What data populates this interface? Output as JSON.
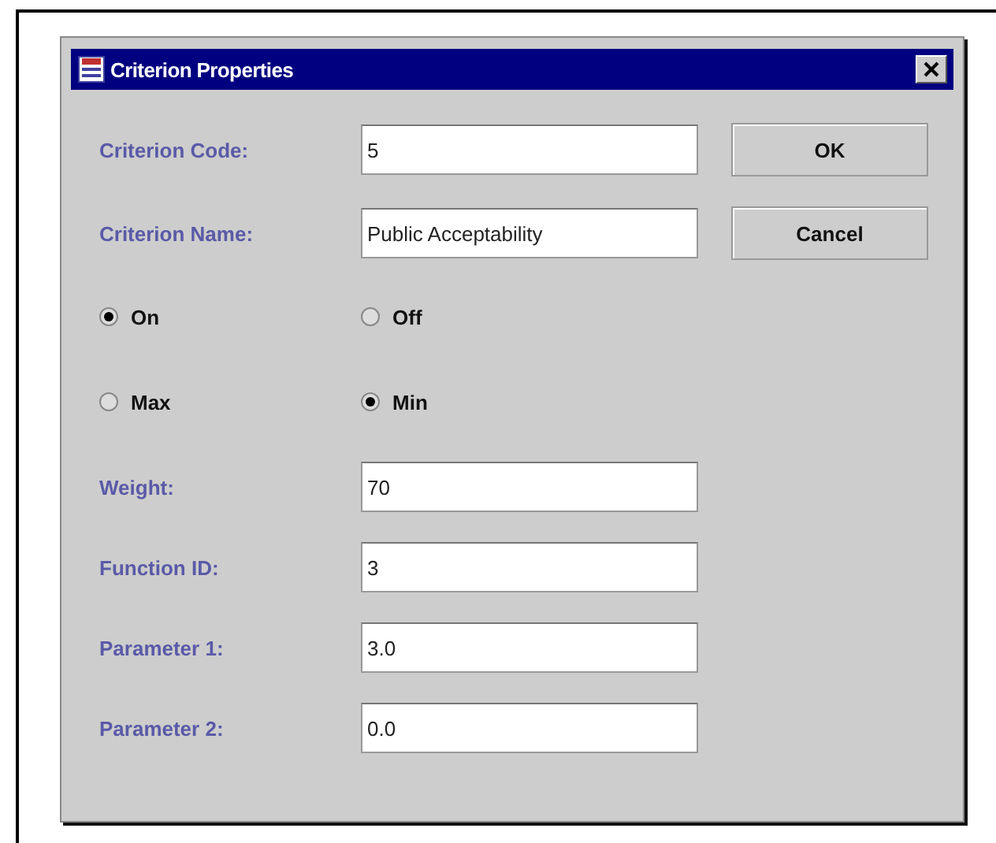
{
  "window": {
    "title": "Criterion Properties"
  },
  "top_fields": [
    {
      "label": "Criterion Code:",
      "value": "5"
    },
    {
      "label": "Criterion Name:",
      "value": "Public Acceptability"
    }
  ],
  "buttons": [
    "OK",
    "Cancel"
  ],
  "radio_groups": [
    [
      {
        "label": "On",
        "selected": true
      },
      {
        "label": "Off",
        "selected": false
      }
    ],
    [
      {
        "label": "Max",
        "selected": false
      },
      {
        "label": "Min",
        "selected": true
      }
    ]
  ],
  "fields": [
    {
      "label": "Weight:",
      "value": "70"
    },
    {
      "label": "Function ID:",
      "value": "3"
    },
    {
      "label": "Parameter 1:",
      "value": "3.0"
    },
    {
      "label": "Parameter 2:",
      "value": "0.0"
    }
  ]
}
